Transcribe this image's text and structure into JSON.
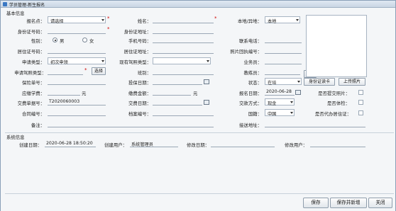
{
  "window": {
    "title": "学员管理-新生报名"
  },
  "sections": {
    "basic": "基本信息",
    "system": "系统信息"
  },
  "labels": {
    "signup_point": "报名点：",
    "name": "姓名：",
    "local_or_remote": "本地/异地：",
    "id_number": "身份证号码：",
    "id_address": "身份证地址：",
    "gender": "性别：",
    "phone": "手机号码：",
    "contact_phone": "联系电话：",
    "residence_no": "居住证号码：",
    "residence_address": "居住证地址：",
    "photo_receipt_no": "照片回执编号：",
    "apply_type": "申请类型：",
    "current_license_type": "现有驾照类型：",
    "salesperson": "业务员：",
    "apply_license_type": "申请驾照类型：",
    "class": "班别：",
    "coach": "教练员：",
    "insurance_no": "保险单号：",
    "insurance_date": "投保日期：",
    "status": "状态：",
    "fee_due": "应缴学费：",
    "fee_due_unit": "元",
    "paid_amount": "缴费金额：",
    "paid_unit": "元",
    "signup_date": "报名日期：",
    "photo_submitted": "是否提交照片：",
    "receipt_no": "交费单据号：",
    "pay_date": "交费日期：",
    "pay_method": "交款方式：",
    "physical_exam": "是否体检：",
    "contract_no": "合同编号：",
    "file_no": "档案编号：",
    "nationality": "国籍：",
    "proxy_residence": "是否代办居住证：",
    "remark": "备注：",
    "pickup_address": "接送地址：",
    "created_date": "创建日期：",
    "created_user": "创建用户：",
    "modified_date": "修改日期：",
    "modified_user": "修改用户："
  },
  "values": {
    "signup_point": "请选择",
    "local_or_remote": "本地",
    "gender_male": "男",
    "gender_female": "女",
    "gender_selected": "男",
    "apply_type": "初次申领",
    "status": "在培",
    "signup_date": "2020-06-28",
    "receipt_no": "T2020060003",
    "pay_method": "现金",
    "nationality": "中国",
    "created_date": "2020-06-28 18:50:20",
    "created_user": "系统管理员"
  },
  "buttons": {
    "choose1": "选择",
    "choose2": "选择",
    "read_id": "身份证读卡",
    "upload_photo": "上传照片",
    "save": "保存",
    "save_new": "保存并新增",
    "close": "关闭"
  }
}
